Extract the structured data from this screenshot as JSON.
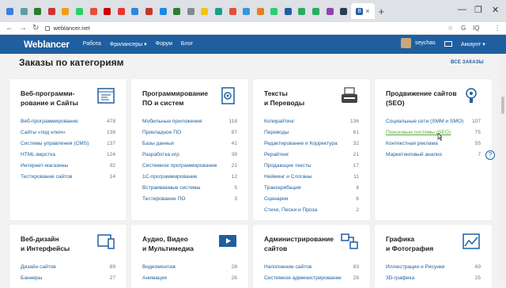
{
  "browser": {
    "tab_favicons": [
      "#3c7de0",
      "#5f9ea0",
      "#2a7d2e",
      "#c33",
      "#f39c12",
      "#25d366",
      "#e74c3c",
      "#c00",
      "#e33",
      "#2e86de",
      "#c0392b",
      "#1e88e5",
      "#2e7d32",
      "#7f8c8d",
      "#f1c40f",
      "#16a085",
      "#e74c3c",
      "#3498db",
      "#e67e22",
      "#2ecc71",
      "#1f5fa0",
      "#27ae60",
      "#27ae60",
      "#8e44ad",
      "#2c3e50"
    ],
    "active_tab_icon": "В",
    "close_glyph": "×",
    "newtab_glyph": "+",
    "minimize_glyph": "—",
    "maximize_glyph": "❐",
    "close_window_glyph": "✕",
    "url": "weblancer.net",
    "ext_icons": [
      "☆",
      "G",
      "IQ",
      "⋮"
    ]
  },
  "header": {
    "logo": "Weblancer",
    "nav": [
      "Работа",
      "Фрилансеры ▾",
      "Форум",
      "Блог"
    ],
    "username": "seychas",
    "account": "Аккаунт ▾"
  },
  "main": {
    "title": "Заказы по категориям",
    "all_orders": "ВСЕ ЗАКАЗЫ"
  },
  "cards": [
    {
      "title": "Веб-программи-рование и Сайты",
      "icon": "code-window-icon",
      "rows": [
        {
          "label": "Веб-программирование",
          "count": "478"
        },
        {
          "label": "Сайты «под ключ»",
          "count": "138"
        },
        {
          "label": "Системы управления (CMS)",
          "count": "137"
        },
        {
          "label": "HTML-верстка",
          "count": "124"
        },
        {
          "label": "Интернет-магазины",
          "count": "92"
        },
        {
          "label": "Тестирование сайтов",
          "count": "14"
        }
      ]
    },
    {
      "title": "Программирование ПО и систем",
      "icon": "gear-document-icon",
      "rows": [
        {
          "label": "Мобильные приложения",
          "count": "118"
        },
        {
          "label": "Прикладное ПО",
          "count": "87"
        },
        {
          "label": "Базы данных",
          "count": "41"
        },
        {
          "label": "Разработка игр",
          "count": "39"
        },
        {
          "label": "Системное программирование",
          "count": "21"
        },
        {
          "label": "1С-программирование",
          "count": "12"
        },
        {
          "label": "Встраиваемые системы",
          "count": "5"
        },
        {
          "label": "Тестирование ПО",
          "count": "3"
        }
      ]
    },
    {
      "title": "Тексты и Переводы",
      "icon": "typewriter-icon",
      "rows": [
        {
          "label": "Копирайтинг",
          "count": "136"
        },
        {
          "label": "Переводы",
          "count": "61"
        },
        {
          "label": "Редактирование и Корректура",
          "count": "32"
        },
        {
          "label": "Рерайтинг",
          "count": "21"
        },
        {
          "label": "Продающие тексты",
          "count": "17"
        },
        {
          "label": "Нейминг и Слоганы",
          "count": "11"
        },
        {
          "label": "Транскрибация",
          "count": "8"
        },
        {
          "label": "Сценарии",
          "count": "6"
        },
        {
          "label": "Стихи, Песни и Проза",
          "count": "2"
        }
      ]
    },
    {
      "title": "Продвижение сайтов (SEO)",
      "icon": "lightbulb-gear-icon",
      "rows": [
        {
          "label": "Социальные сети (SMM и SMO)",
          "count": "107"
        },
        {
          "label": "Поисковые системы (SEO)",
          "count": "75"
        },
        {
          "label": "Контекстная реклама",
          "count": "55"
        },
        {
          "label": "Маркетинговый анализ",
          "count": "7"
        }
      ]
    },
    {
      "title": "Веб-дизайн и Интерфейсы",
      "icon": "devices-icon",
      "rows": [
        {
          "label": "Дизайн сайтов",
          "count": "89"
        },
        {
          "label": "Баннеры",
          "count": "27"
        }
      ]
    },
    {
      "title": "Аудио, Видео и Мультимедиа",
      "icon": "play-screen-icon",
      "rows": [
        {
          "label": "Видеомонтаж",
          "count": "28"
        },
        {
          "label": "Анимация",
          "count": "26"
        }
      ]
    },
    {
      "title": "Администрирование сайтов",
      "icon": "network-icon",
      "rows": [
        {
          "label": "Наполнение сайтов",
          "count": "83"
        },
        {
          "label": "Системное администрирование",
          "count": "28"
        }
      ]
    },
    {
      "title": "Графика и Фотография",
      "icon": "image-chart-icon",
      "rows": [
        {
          "label": "Иллюстрации и Рисунки",
          "count": "69"
        },
        {
          "label": "3D-графика",
          "count": "25"
        }
      ]
    }
  ],
  "help_glyph": "?"
}
